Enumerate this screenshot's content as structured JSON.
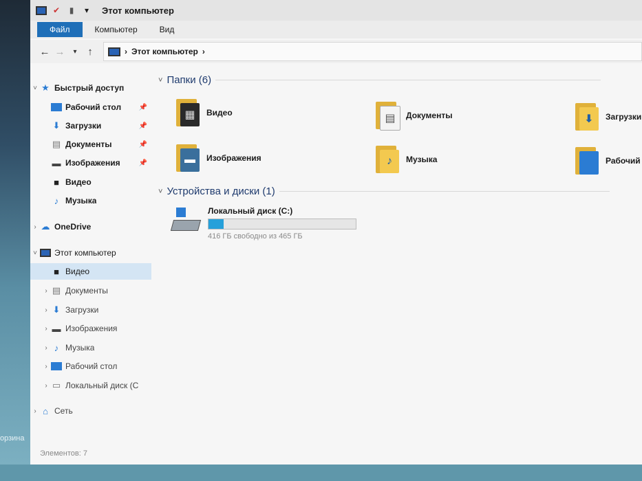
{
  "window": {
    "title": "Этот компьютер"
  },
  "ribbon": {
    "tabs": [
      "Файл",
      "Компьютер",
      "Вид"
    ]
  },
  "address": {
    "path": "Этот компьютер"
  },
  "nav": {
    "quick_access": "Быстрый доступ",
    "quick_items": [
      "Рабочий стол",
      "Загрузки",
      "Документы",
      "Изображения",
      "Видео",
      "Музыка"
    ],
    "onedrive": "OneDrive",
    "this_pc": "Этот компьютер",
    "pc_items": [
      "Видео",
      "Документы",
      "Загрузки",
      "Изображения",
      "Музыка",
      "Рабочий стол",
      "Локальный диск (C"
    ],
    "network": "Сеть"
  },
  "folders_group": "Папки (6)",
  "folders": [
    "Видео",
    "Документы",
    "Загрузки",
    "Изображения",
    "Музыка",
    "Рабочий"
  ],
  "devices_group": "Устройства и диски (1)",
  "drive": {
    "name": "Локальный диск (C:)",
    "free_text": "416 ГБ свободно из 465 ГБ",
    "used_fraction": 0.105
  },
  "status": {
    "items": "Элементов: 7"
  },
  "desktop": {
    "label": "орзина"
  },
  "colors": {
    "accent": "#1f6fb8",
    "selection": "#d4e5f4",
    "folder": "#f3c94f",
    "drive_bar": "#26a0da"
  },
  "icons": {
    "back": "arrow-left-icon",
    "forward": "arrow-right-icon",
    "up": "arrow-up-icon",
    "pin": "pin-icon"
  }
}
